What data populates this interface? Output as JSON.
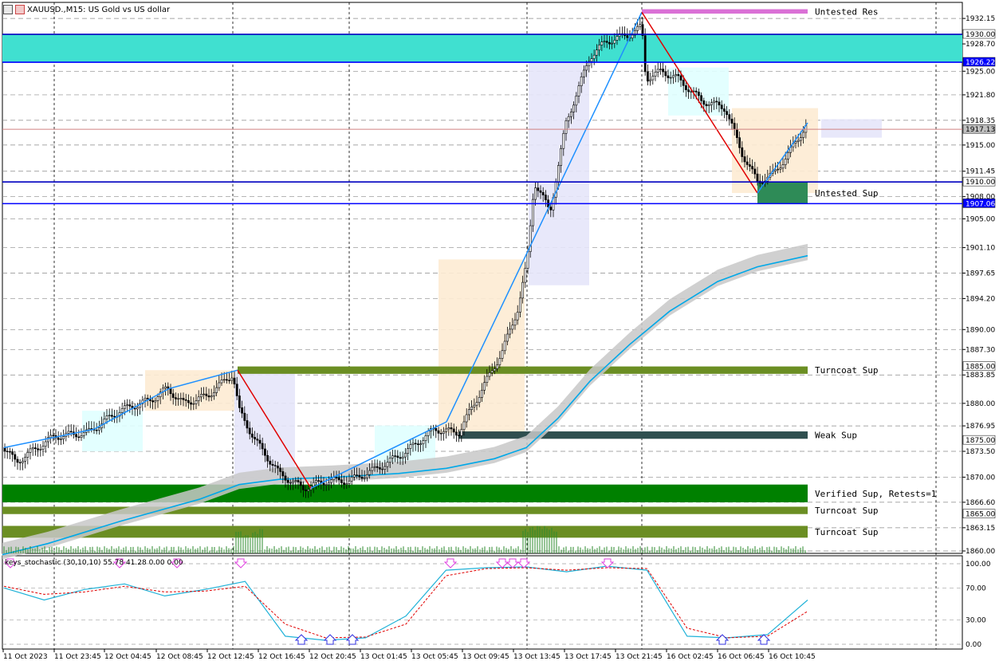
{
  "header": {
    "symbol_title": "XAUUSD.,M15: US Gold vs US dollar"
  },
  "indicator": {
    "title": "keys_stochastic (30,10,10) 55.78 41.28 0.00 0.00",
    "levels": [
      "100.00",
      "70.00",
      "30.00",
      "0.00"
    ]
  },
  "price_axis": {
    "ticks": [
      "1932.15",
      "1928.70",
      "1925.00",
      "1921.80",
      "1918.35",
      "1915.00",
      "1911.45",
      "1908.00",
      "1905.00",
      "1901.10",
      "1897.65",
      "1894.20",
      "1890.00",
      "1887.30",
      "1883.85",
      "1880.00",
      "1876.95",
      "1873.50",
      "1870.00",
      "1866.60",
      "1863.15",
      "1860.00"
    ],
    "highlight_labels": [
      {
        "text": "1930.00",
        "bg": "#ffffff"
      },
      {
        "text": "1926.22",
        "bg": "#0000ff"
      },
      {
        "text": "1917.13",
        "bg": "#c0c0c0"
      },
      {
        "text": "1910.00",
        "bg": "#ffffff"
      },
      {
        "text": "1907.06",
        "bg": "#0000ff"
      },
      {
        "text": "1885.00",
        "bg": "#ffffff"
      },
      {
        "text": "1875.00",
        "bg": "#ffffff"
      },
      {
        "text": "1865.00",
        "bg": "#ffffff"
      }
    ]
  },
  "time_axis": {
    "ticks": [
      "11 Oct 2023",
      "11 Oct 23:45",
      "12 Oct 04:45",
      "12 Oct 08:45",
      "12 Oct 12:45",
      "12 Oct 16:45",
      "12 Oct 20:45",
      "13 Oct 01:45",
      "13 Oct 05:45",
      "13 Oct 09:45",
      "13 Oct 13:45",
      "13 Oct 17:45",
      "13 Oct 21:45",
      "16 Oct 02:45",
      "16 Oct 06:45",
      "16 Oct 10:45"
    ]
  },
  "zones": [
    {
      "label": "Untested Res",
      "kind": "resistance",
      "color": "#da70d6"
    },
    {
      "label": "Untested Sup",
      "kind": "support",
      "color": "#2e8b57"
    },
    {
      "label": "Turncoat Sup",
      "kind": "support",
      "color": "#6b8e23"
    },
    {
      "label": "Weak Sup",
      "kind": "support",
      "color": "#2f4f4f"
    },
    {
      "label": "Verified Sup, Retests=1",
      "kind": "support",
      "color": "#008000"
    },
    {
      "label": "Turncoat Sup",
      "kind": "support",
      "color": "#6b8e23"
    },
    {
      "label": "Turncoat Sup",
      "kind": "support",
      "color": "#6b8e23"
    }
  ],
  "colors": {
    "up_trend": "#1e90ff",
    "down_trend": "#e00000",
    "ma": "#00a8e8",
    "band": "#c8c8c8",
    "resistance_band": "#40e0d0",
    "stoch_main": "#20b2d8",
    "stoch_signal": "#e00000"
  },
  "chart_data": {
    "type": "line",
    "symbol": "XAUUSD.",
    "timeframe": "M15",
    "ylim": [
      1860,
      1934
    ],
    "x": [
      "11 Oct 2023",
      "11 Oct 23:45",
      "12 Oct 04:45",
      "12 Oct 08:45",
      "12 Oct 12:45",
      "12 Oct 16:45",
      "12 Oct 20:45",
      "13 Oct 01:45",
      "13 Oct 05:45",
      "13 Oct 09:45",
      "13 Oct 13:45",
      "13 Oct 17:45",
      "13 Oct 21:45",
      "16 Oct 02:45",
      "16 Oct 06:45",
      "16 Oct 10:45"
    ],
    "series": [
      {
        "name": "XAUUSD.",
        "values": [
          1874.5,
          1877.5,
          1880.5,
          1883.0,
          1884.5,
          1869.5,
          1868.5,
          1872.0,
          1877.0,
          1890.0,
          1921.0,
          1930.0,
          1924.0,
          1920.0,
          1910.5,
          1918.0
        ]
      }
    ],
    "zigzag": [
      {
        "time": "11 Oct 2023",
        "price": 1874.0
      },
      {
        "time": "11 Oct 23:45",
        "price": 1876.5
      },
      {
        "time": "12 Oct 08:45",
        "price": 1882.0
      },
      {
        "time": "12 Oct 12:45",
        "price": 1884.5
      },
      {
        "time": "12 Oct 20:45",
        "price": 1868.5
      },
      {
        "time": "13 Oct 05:45",
        "price": 1877.5
      },
      {
        "time": "13 Oct 21:45",
        "price": 1933.0
      },
      {
        "time": "16 Oct 06:45",
        "price": 1908.5
      },
      {
        "time": "16 Oct 10:45",
        "price": 1918.0
      }
    ],
    "horizontal_levels": [
      1930.0,
      1926.22,
      1917.13,
      1910.0,
      1907.06
    ],
    "stochastic": {
      "ylim": [
        0,
        100
      ],
      "main": [
        70,
        55,
        68,
        75,
        60,
        68,
        78,
        10,
        5,
        8,
        35,
        92,
        95,
        96,
        90,
        97,
        92,
        10,
        8,
        12,
        55
      ],
      "signal": [
        72,
        62,
        65,
        72,
        65,
        66,
        72,
        25,
        8,
        9,
        25,
        85,
        94,
        95,
        92,
        95,
        94,
        20,
        8,
        10,
        41
      ]
    }
  }
}
